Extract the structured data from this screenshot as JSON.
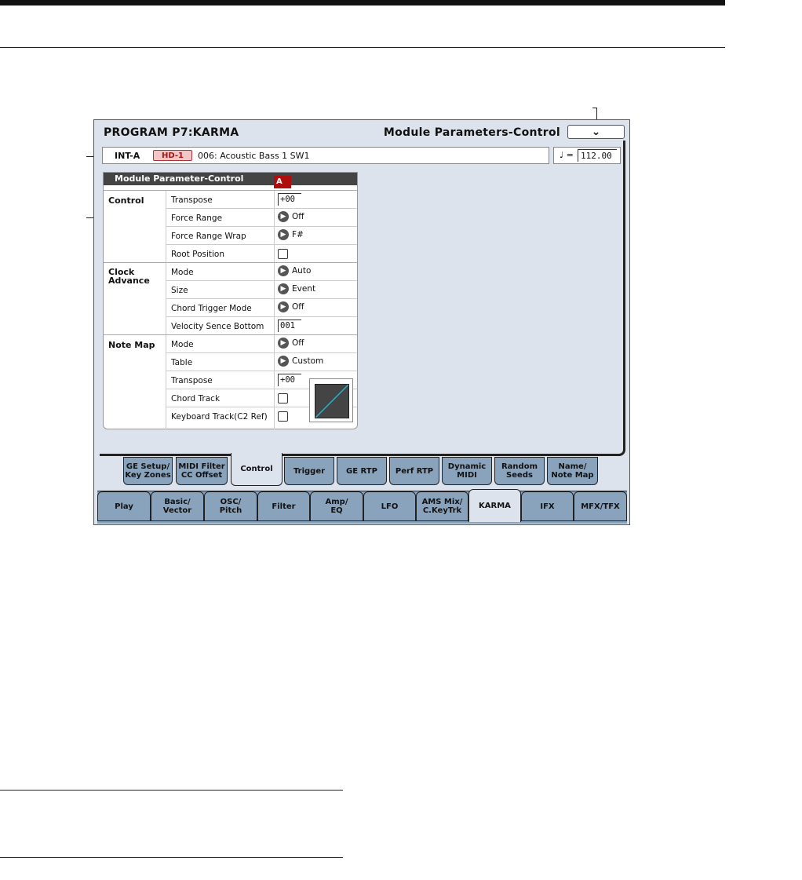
{
  "screen": {
    "title": "PROGRAM P7:KARMA",
    "page_title": "Module Parameters-Control",
    "menu_icon": "chevron-down-icon"
  },
  "program": {
    "bank": "INT-A",
    "hd_badge": "HD-1",
    "name": "006: Acoustic Bass 1 SW1",
    "tempo_symbol": "♩ =",
    "tempo": "112.00"
  },
  "panel": {
    "title": "Module Parameter-Control",
    "module_badge": "A",
    "groups": {
      "control": "Control",
      "clock_line1": "Clock",
      "clock_line2": "Advance",
      "notemap": "Note Map"
    },
    "rows": [
      {
        "label": "Transpose",
        "value": "+00"
      },
      {
        "label": "Force Range",
        "value": "Off"
      },
      {
        "label": "Force Range Wrap",
        "value": "F#"
      },
      {
        "label": "Root Position",
        "checked": false
      },
      {
        "label": "Mode",
        "value": "Auto"
      },
      {
        "label": "Size",
        "value": "Event"
      },
      {
        "label": "Chord Trigger Mode",
        "value": "Off"
      },
      {
        "label": "Velocity Sence Bottom",
        "value": "001"
      },
      {
        "label": "Mode",
        "value": "Off"
      },
      {
        "label": "Table",
        "value": "Custom"
      },
      {
        "label": "Transpose",
        "value": "+00"
      },
      {
        "label": "Chord Track",
        "checked": false
      },
      {
        "label": "Keyboard Track(C2 Ref)",
        "checked": false
      }
    ]
  },
  "sub_tabs": [
    {
      "l1": "GE Setup/",
      "l2": "Key Zones"
    },
    {
      "l1": "MIDI Filter",
      "l2": "CC Offset"
    },
    {
      "l1": "Control",
      "l2": "",
      "active": true
    },
    {
      "l1": "Trigger",
      "l2": ""
    },
    {
      "l1": "GE RTP",
      "l2": ""
    },
    {
      "l1": "Perf RTP",
      "l2": ""
    },
    {
      "l1": "Dynamic",
      "l2": "MIDI"
    },
    {
      "l1": "Random",
      "l2": "Seeds"
    },
    {
      "l1": "Name/",
      "l2": "Note Map"
    }
  ],
  "main_tabs": [
    {
      "l1": "Play",
      "l2": ""
    },
    {
      "l1": "Basic/",
      "l2": "Vector"
    },
    {
      "l1": "OSC/",
      "l2": "Pitch"
    },
    {
      "l1": "Filter",
      "l2": ""
    },
    {
      "l1": "Amp/",
      "l2": "EQ"
    },
    {
      "l1": "LFO",
      "l2": ""
    },
    {
      "l1": "AMS Mix/",
      "l2": "C.KeyTrk"
    },
    {
      "l1": "KARMA",
      "l2": "",
      "active": true
    },
    {
      "l1": "IFX",
      "l2": ""
    },
    {
      "l1": "MFX/TFX",
      "l2": ""
    }
  ],
  "colors": {
    "screen_bg": "#dde3ec",
    "tab_bg": "#8aa3bd",
    "badge_red": "#b00d0d",
    "graph_line": "#2ab0c8"
  }
}
